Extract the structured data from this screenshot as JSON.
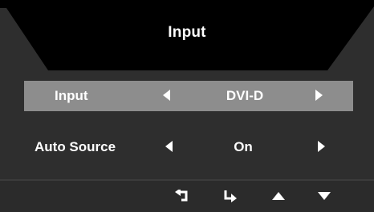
{
  "menu": {
    "title": "Input",
    "rows": [
      {
        "label": "Input",
        "value": "DVI-D",
        "selected": true
      },
      {
        "label": "Auto Source",
        "value": "On",
        "selected": false
      }
    ]
  },
  "footer": {
    "buttons": [
      {
        "icon": "return-icon"
      },
      {
        "icon": "enter-icon"
      },
      {
        "icon": "up-arrow-icon"
      },
      {
        "icon": "down-arrow-icon"
      }
    ]
  },
  "colors": {
    "background": "#2e2e2e",
    "header": "#000000",
    "selected_row": "#8d8d8d",
    "text": "#ffffff"
  }
}
